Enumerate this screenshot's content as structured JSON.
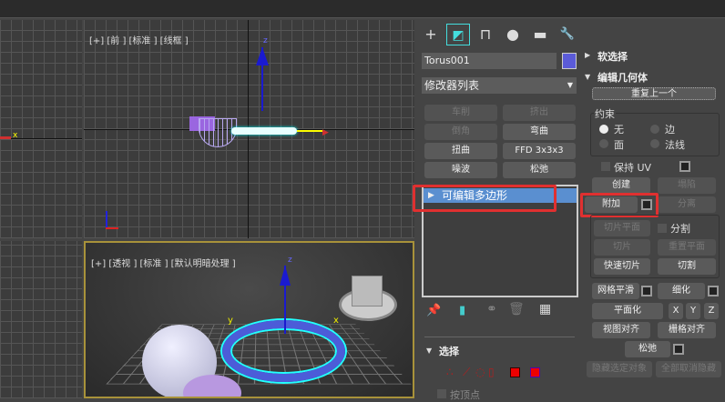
{
  "viewports": {
    "top_label": "[+] [前 ] [标准 ] [线框 ]",
    "persp_label": "[+] [透视 ] [标准 ] [默认明暗处理 ]",
    "axis_x": "x",
    "axis_y": "y",
    "axis_z": "z"
  },
  "command_panel": {
    "tabs": [
      {
        "icon": "create-icon",
        "glyph": "+"
      },
      {
        "icon": "modify-icon",
        "glyph": "◩"
      },
      {
        "icon": "hierarchy-icon",
        "glyph": "⊓"
      },
      {
        "icon": "motion-icon",
        "glyph": "●"
      },
      {
        "icon": "display-icon",
        "glyph": "▬"
      },
      {
        "icon": "utilities-icon",
        "glyph": "🔧"
      }
    ],
    "object_name": "Torus001",
    "object_color": "#5b5bd8",
    "modifier_list": "修改器列表",
    "modifier_buttons": [
      "车削",
      "挤出",
      "倒角",
      "弯曲",
      "扭曲",
      "FFD 3x3x3",
      "噪波",
      "松弛"
    ],
    "stack_item": "可编辑多边形",
    "rollout_select": "选择",
    "by_vertex": "按顶点"
  },
  "right_panel": {
    "soft_select": "软选择",
    "edit_geometry": "编辑几何体",
    "repeat_last": "重复上一个",
    "constraints": "约束",
    "constraint_options": [
      "无",
      "边",
      "面",
      "法线"
    ],
    "preserve_uv": "保持 UV",
    "create": "创建",
    "collapse": "塌陷",
    "attach": "附加",
    "detach": "分离",
    "slice_plane": "切片平面",
    "split": "分割",
    "slice": "切片",
    "reset_plane": "重置平面",
    "quickslice": "快速切片",
    "cut": "切割",
    "meshsmooth": "网格平滑",
    "tessellate": "细化",
    "make_planar": "平面化",
    "x": "X",
    "y": "Y",
    "z": "Z",
    "view_align": "视图对齐",
    "grid_align": "栅格对齐",
    "relax": "松弛",
    "hide_selected": "隐藏选定对象",
    "unhide_all": "全部取消隐藏"
  },
  "colors": {
    "highlight": "#e03030",
    "selection": "#5a8fd0"
  }
}
